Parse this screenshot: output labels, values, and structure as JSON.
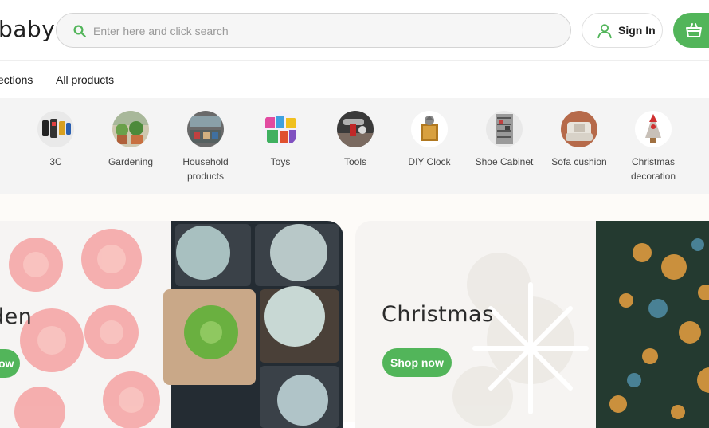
{
  "header": {
    "logo_text": "baby",
    "search": {
      "placeholder": "Enter here and click search",
      "value": ""
    },
    "signin_label": "Sign In"
  },
  "nav": {
    "items": [
      "ections",
      "All products"
    ]
  },
  "categories": [
    {
      "name": "3C",
      "icon": "electronics-icon"
    },
    {
      "name": "Gardening",
      "icon": "gardening-icon"
    },
    {
      "name": "Household products",
      "icon": "household-icon"
    },
    {
      "name": "Toys",
      "icon": "toys-icon"
    },
    {
      "name": "Tools",
      "icon": "tools-icon"
    },
    {
      "name": "DIY Clock",
      "icon": "clock-icon"
    },
    {
      "name": "Shoe Cabinet",
      "icon": "shoe-cabinet-icon"
    },
    {
      "name": "Sofa cushion",
      "icon": "sofa-icon"
    },
    {
      "name": "Christmas decoration",
      "icon": "christmas-tree-icon"
    }
  ],
  "banners": [
    {
      "title": "den",
      "button": "ow"
    },
    {
      "title": "Christmas",
      "button": "Shop now"
    }
  ],
  "colors": {
    "accent": "#52b55a",
    "text": "#222222",
    "strip": "#f4f4f4"
  }
}
